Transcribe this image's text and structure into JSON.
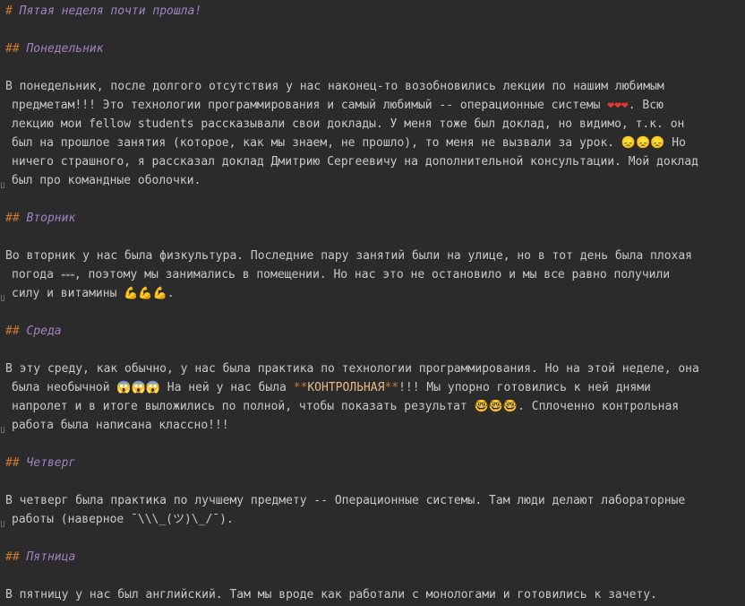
{
  "title": {
    "hash": "#",
    "text": " Пятая неделя почти прошла!"
  },
  "monday": {
    "hash": "##",
    "heading": " Понедельник",
    "lines": [
      "В понедельник, после долгого отсутствия у нас наконец-то возобновились лекции по нашим любимым",
      "предметам!!! Это технологии программирования и самый любимый -- операционные системы ",
      ". Всю",
      "лекцию мои fellow students рассказывали свои доклады. У меня тоже был доклад, но видимо, т.к. он",
      "был на прошлое занятия (которое, как мы знаем, не прошло), то меня не вызвали за урок. ",
      " Но",
      "ничего страшного, я рассказал доклад Дмитрию Сергеевичу на дополнительной консультации. Мой доклад",
      "был про командные оболочки."
    ],
    "emoji_hearts": "❤❤❤",
    "emoji_weary": "😞😞😞"
  },
  "tuesday": {
    "hash": "##",
    "heading": " Вторник",
    "lines": [
      "Во вторник у нас была физкультура. Последние пару занятий были на улице, но в тот день была плохая",
      "погода ",
      ", поэтому мы занимались в помещении. Но нас это не остановило и мы все равно получили",
      "силу и витамины ",
      "."
    ],
    "emoji_weather": "☔☔☔",
    "emoji_muscle": "💪💪💪"
  },
  "wednesday": {
    "hash": "##",
    "heading": " Среда",
    "lines": [
      "В эту среду, как обычно, у нас была практика по технологии программирования. Но на этой неделе, она",
      "была необычной ",
      " На ней у нас была ",
      "!!! Мы упорно готовились к ней днями",
      "напролет и в итоге выложились по полной, чтобы показать результат ",
      ". Сплоченно контрольная",
      "работа была написана классно!!!"
    ],
    "emoji_scream": "😱😱😱",
    "bold_mark": "**",
    "bold_text": "КОНТРОЛЬНАЯ",
    "emoji_nerd": "🤓🤓🤓"
  },
  "thursday": {
    "hash": "##",
    "heading": " Четверг",
    "lines": [
      "В четверг была практика по лучшему предмету -- Операционные системы. Там люди делают лабораторные",
      "работы (наверное ¯\\\\\\_(ツ)\\_/¯)."
    ]
  },
  "friday": {
    "hash": "##",
    "heading": " Пятница",
    "lines": [
      "В пятницу у нас был английский. Там мы вроде как работали с монологами и готовились к зачету."
    ]
  }
}
